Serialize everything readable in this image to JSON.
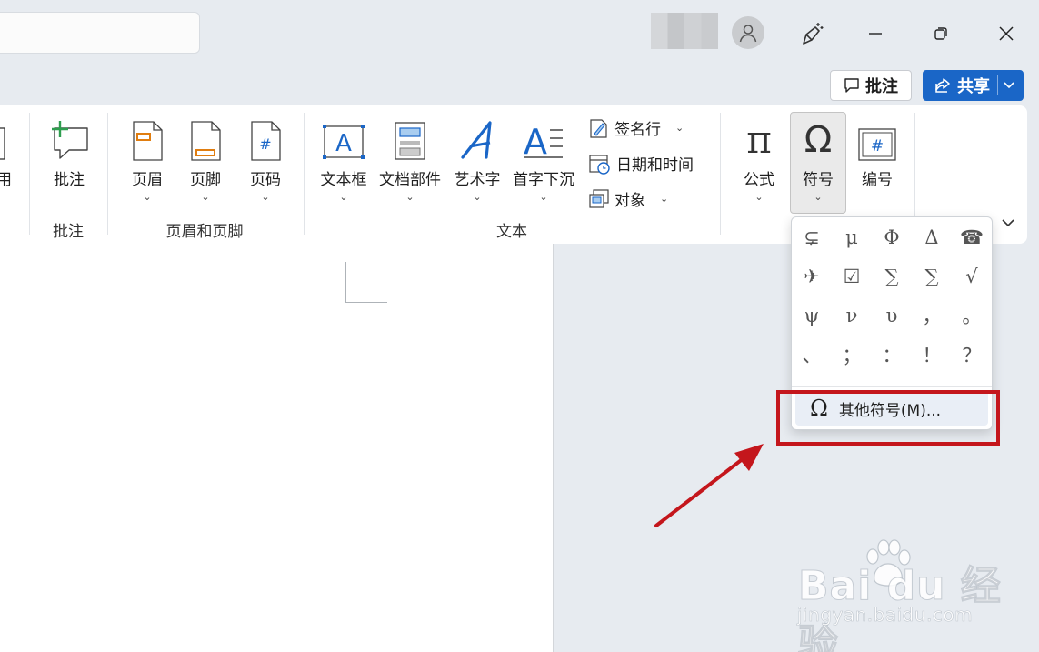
{
  "title_bar": {
    "window_buttons": [
      "minimize",
      "restore",
      "close"
    ]
  },
  "actions": {
    "comments_label": "批注",
    "share_label": "共享"
  },
  "ribbon": {
    "partial_label": "用",
    "groups": {
      "comments": {
        "label": "批注",
        "commands": {
          "comment": "批注"
        }
      },
      "header_footer": {
        "label": "页眉和页脚",
        "commands": {
          "header": "页眉",
          "footer": "页脚",
          "page_number": "页码"
        }
      },
      "text": {
        "label": "文本",
        "commands": {
          "text_box": "文本框",
          "quick_parts": "文档部件",
          "wordart": "艺术字",
          "drop_cap": "首字下沉",
          "signature_line": "签名行",
          "date_time": "日期和时间",
          "object": "对象"
        }
      },
      "symbols": {
        "commands": {
          "equation": "公式",
          "symbol": "符号",
          "numbering": "编号"
        }
      }
    }
  },
  "symbol_menu": {
    "symbols": [
      "⊊",
      "μ",
      "Φ",
      "Δ",
      "☎",
      "✈",
      "☑",
      "∑",
      "∑",
      "√",
      "ψ",
      "ν",
      "υ",
      "，",
      "。",
      "、",
      "；",
      "：",
      "！",
      "？"
    ],
    "more_symbols_label": "其他符号(M)..."
  },
  "watermark": {
    "logo_text": "Bai du 经验",
    "url_text": "jingyan.baidu.com"
  },
  "colors": {
    "accent": "#1a66c7",
    "highlight_box": "#c4161c",
    "arrow": "#c4161c"
  }
}
